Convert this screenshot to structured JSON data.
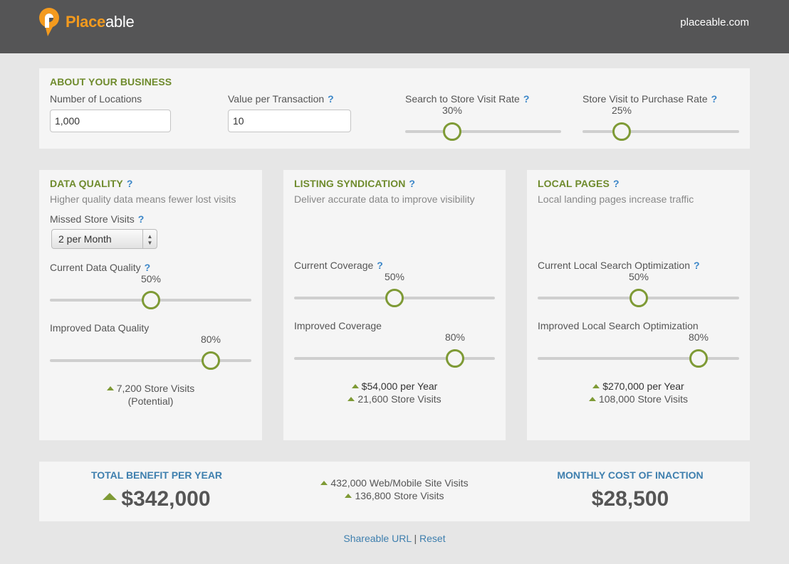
{
  "header": {
    "brand_part1": "Place",
    "brand_part2": "able",
    "site_link": "placeable.com"
  },
  "about": {
    "title": "ABOUT YOUR BUSINESS",
    "locations_label": "Number of Locations",
    "locations_value": "1,000",
    "value_label": "Value per Transaction",
    "value_value": "10",
    "help": "?",
    "visit_rate_label": "Search to Store Visit Rate",
    "visit_rate_value": "30%",
    "visit_rate_pct": 30,
    "purchase_rate_label": "Store Visit to Purchase Rate",
    "purchase_rate_value": "25%",
    "purchase_rate_pct": 25
  },
  "data_quality": {
    "title": "DATA QUALITY",
    "help": "?",
    "subtitle": "Higher quality data means fewer lost visits",
    "missed_label": "Missed Store Visits",
    "missed_value": "2 per Month",
    "current_label": "Current Data Quality",
    "current_value": "50%",
    "current_pct": 50,
    "improved_label": "Improved Data Quality",
    "improved_value": "80%",
    "improved_pct": 80,
    "result_line1": "7,200 Store Visits",
    "result_line2": "(Potential)"
  },
  "listing_syndication": {
    "title": "LISTING SYNDICATION",
    "help": "?",
    "subtitle": "Deliver accurate data to improve visibility",
    "current_label": "Current Coverage",
    "current_value": "50%",
    "current_pct": 50,
    "improved_label": "Improved Coverage",
    "improved_value": "80%",
    "improved_pct": 80,
    "result_line1": "$54,000 per Year",
    "result_line2": "21,600 Store Visits"
  },
  "local_pages": {
    "title": "LOCAL PAGES",
    "help": "?",
    "subtitle": "Local landing pages increase traffic",
    "current_label": "Current Local Search Optimization",
    "current_value": "50%",
    "current_pct": 50,
    "improved_label": "Improved Local Search Optimization",
    "improved_value": "80%",
    "improved_pct": 80,
    "result_line1": "$270,000 per Year",
    "result_line2": "108,000 Store Visits"
  },
  "totals": {
    "benefit_title": "TOTAL BENEFIT PER YEAR",
    "benefit_value": "$342,000",
    "visits_line1": "432,000 Web/Mobile Site Visits",
    "visits_line2": "136,800 Store Visits",
    "cost_title": "MONTHLY COST OF INACTION",
    "cost_value": "$28,500"
  },
  "footer": {
    "share_link": "Shareable URL",
    "separator": "|",
    "reset_link": "Reset"
  },
  "colors": {
    "header_bg": "#555556",
    "brand_orange": "#f39a1e",
    "accent_green": "#7e9a35",
    "heading_blue": "#3e7fae"
  }
}
